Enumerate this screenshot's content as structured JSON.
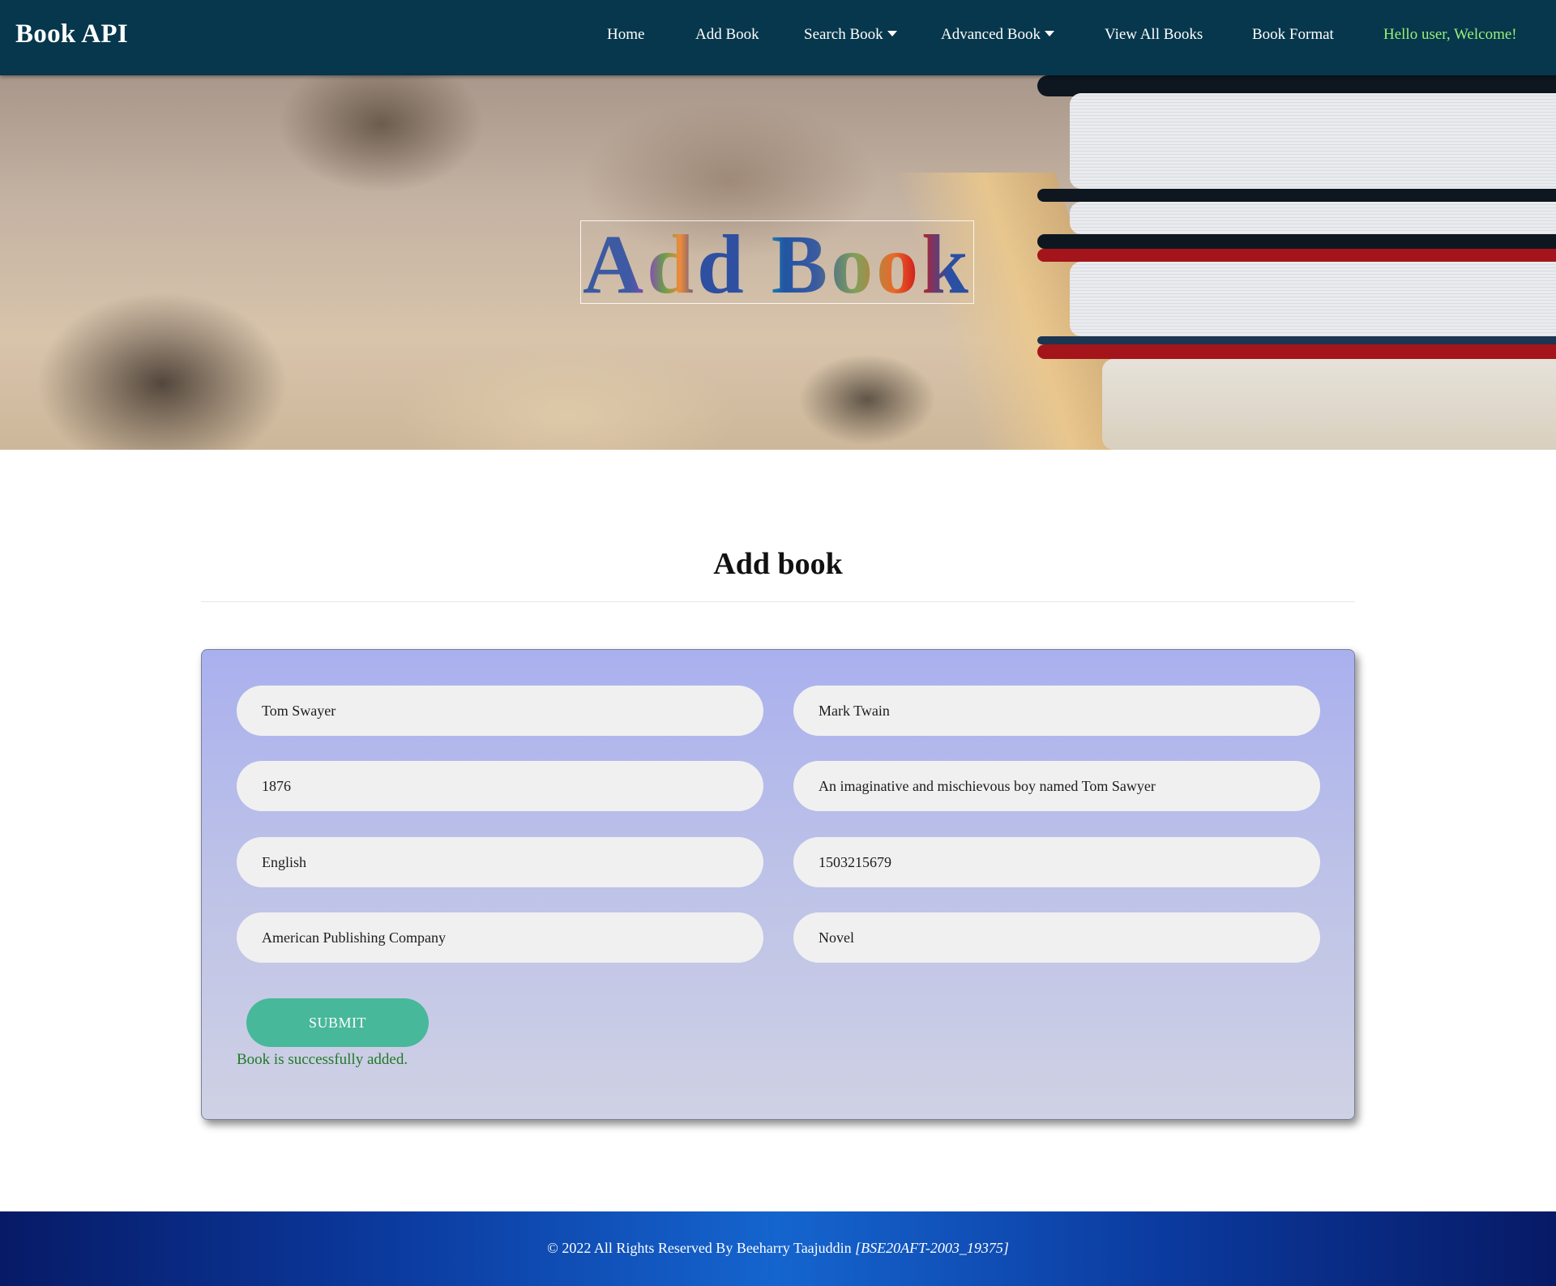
{
  "navbar": {
    "brand": "Book API",
    "items": [
      {
        "label": "Home"
      },
      {
        "label": "Add Book"
      },
      {
        "label": "Search Book"
      },
      {
        "label": "Advanced Book"
      },
      {
        "label": "View All Books"
      },
      {
        "label": "Book Format"
      }
    ],
    "welcome": "Hello user, Welcome!"
  },
  "hero": {
    "title": "Add Book"
  },
  "main": {
    "title": "Add book",
    "form": {
      "fields": {
        "title": "Tom Swayer",
        "author": "Mark Twain",
        "year": "1876",
        "description": "An imaginative and mischievous boy named Tom Sawyer",
        "language": "English",
        "isbn": "1503215679",
        "publisher": "American Publishing Company",
        "genre": "Novel"
      },
      "submit_label": "SUBMIT",
      "status_message": "Book is successfully added."
    }
  },
  "footer": {
    "text": "© 2022 All Rights Reserved By Beeharry Taajuddin ",
    "id": "[BSE20AFT-2003_19375]"
  },
  "colors": {
    "navbar_bg": "#06374c",
    "welcome_text": "#9bf07a",
    "submit_button": "#47b89a",
    "status_success": "#1f7a26",
    "footer_center": "#1565cf"
  }
}
